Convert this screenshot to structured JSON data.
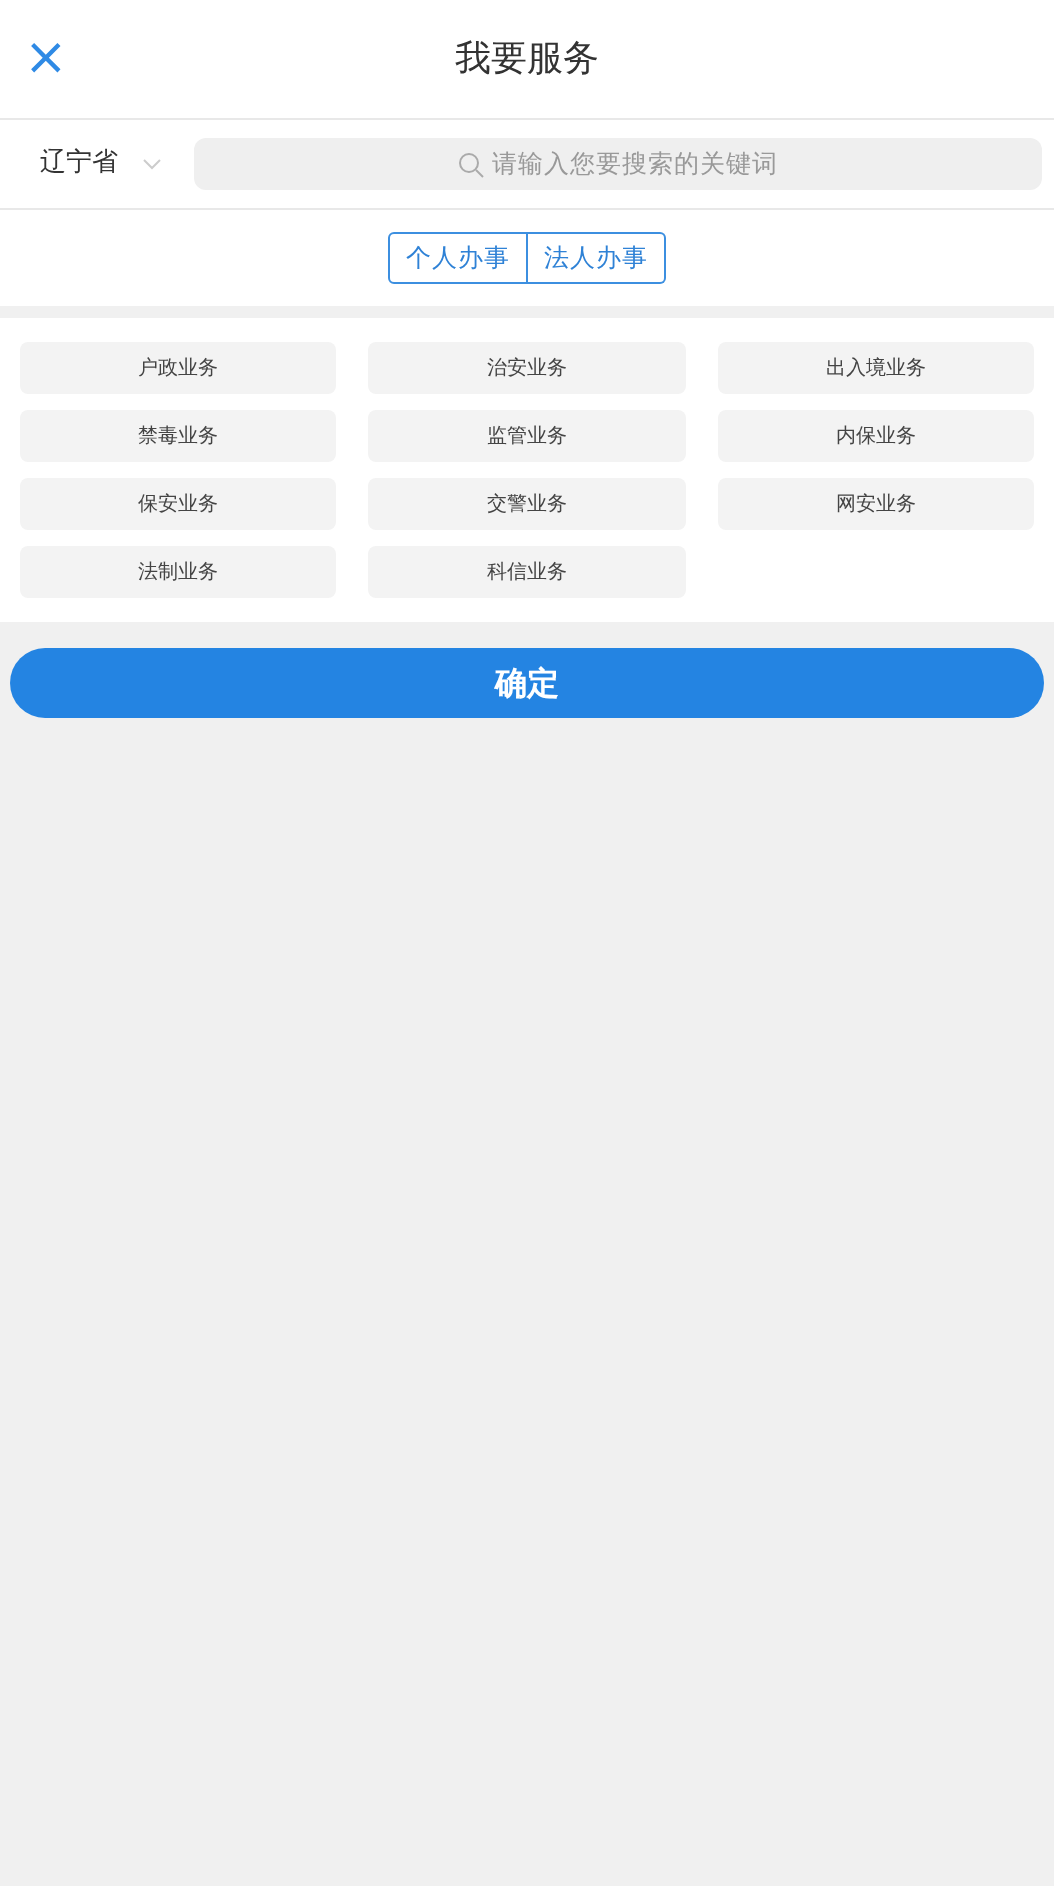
{
  "header": {
    "close_icon": "×",
    "title": "我要服务"
  },
  "search_bar": {
    "region": "辽宁省",
    "placeholder": "请输入您要搜索的关键词"
  },
  "tabs": [
    {
      "label": "个人办事",
      "selected": false
    },
    {
      "label": "法人办事",
      "selected": false
    }
  ],
  "services": [
    {
      "label": "户政业务",
      "selected": false
    },
    {
      "label": "治安业务",
      "selected": false
    },
    {
      "label": "出入境业务",
      "selected": false
    },
    {
      "label": "禁毒业务",
      "selected": false
    },
    {
      "label": "监管业务",
      "selected": false
    },
    {
      "label": "内保业务",
      "selected": false
    },
    {
      "label": "保安业务",
      "selected": false
    },
    {
      "label": "交警业务",
      "selected": false
    },
    {
      "label": "网安业务",
      "selected": false
    },
    {
      "label": "法制业务",
      "selected": false
    },
    {
      "label": "科信业务",
      "selected": false
    }
  ],
  "confirm_button": "确定"
}
